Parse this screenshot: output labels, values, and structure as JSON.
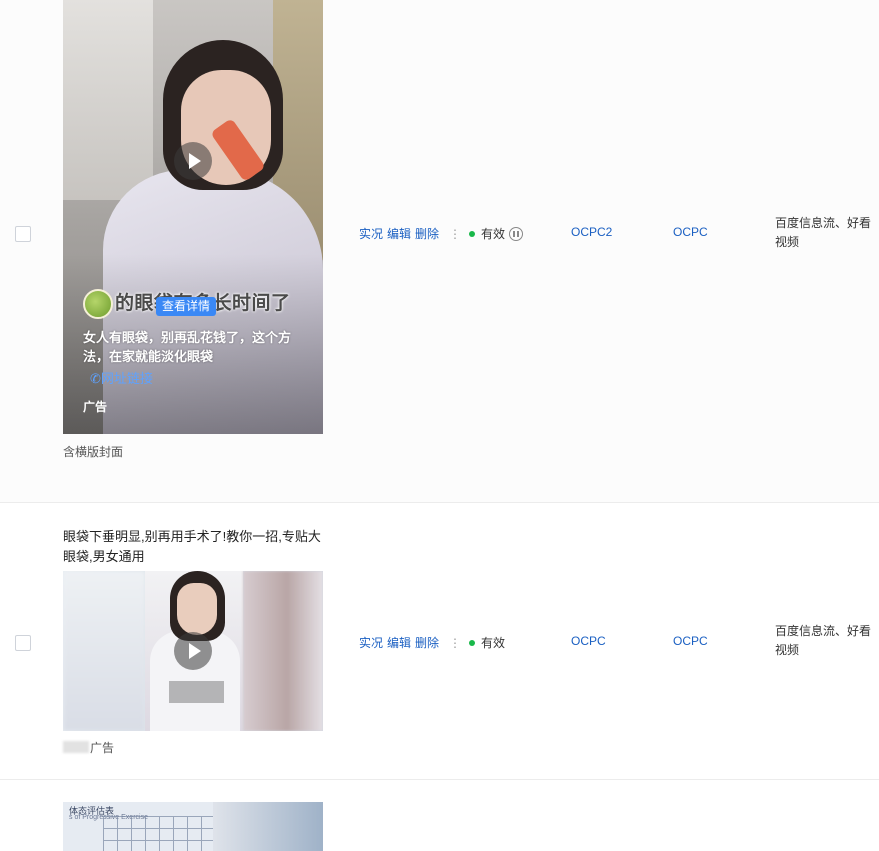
{
  "rows": [
    {
      "thumbnail": {
        "overlay_subtitle": "的眼袋有多长时间了",
        "detail_button": "查看详情",
        "ad_description": "女人有眼袋，别再乱花钱了，这个方法，在家就能淡化眼袋",
        "url_link": "网址链接",
        "ad_tag": "广告"
      },
      "cover_note": "含横版封面",
      "actions": [
        "实况",
        "编辑",
        "删除"
      ],
      "status": "有效",
      "status_color": "#19b84a",
      "bid_type_a": "OCPC2",
      "bid_type_b": "OCPC",
      "placement": "百度信息流、好看视频"
    },
    {
      "title": "眼袋下垂明显,别再用手术了!教你一招,专贴大眼袋,男女通用",
      "account_suffix": "广告",
      "actions": [
        "实况",
        "编辑",
        "删除"
      ],
      "status": "有效",
      "status_color": "#19b84a",
      "bid_type_a": "OCPC",
      "bid_type_b": "OCPC",
      "placement": "百度信息流、好看视频"
    },
    {
      "thumbnail": {
        "chart_title": "体态评估表",
        "chart_subtitle": "s of Progressive Exercise"
      }
    }
  ],
  "colors": {
    "link": "#1a5fc2",
    "detail_button": "#3a88f5",
    "status_active": "#19b84a"
  }
}
